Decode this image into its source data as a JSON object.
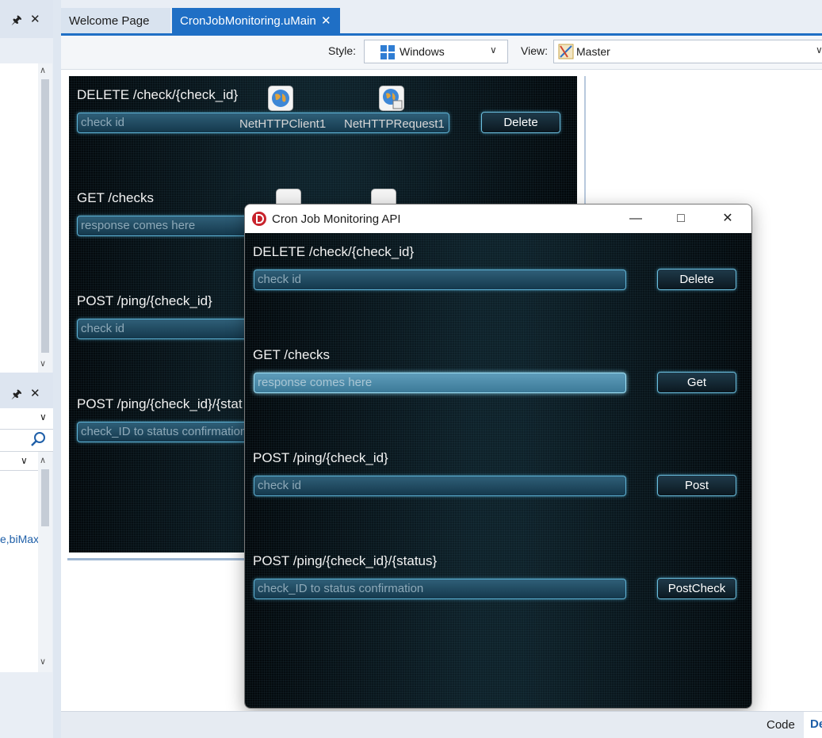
{
  "tabs": [
    {
      "label": "Welcome Page",
      "active": false
    },
    {
      "label": "CronJobMonitoring.uMain",
      "active": true
    }
  ],
  "toolbar": {
    "style_label": "Style:",
    "style_value": "Windows",
    "view_label": "View:",
    "view_value": "Master"
  },
  "left_panel": {
    "truncated_text": "e,biMax"
  },
  "designer_form": {
    "sections": [
      {
        "heading": "DELETE /check/{check_id}",
        "placeholder": "check id",
        "button": "Delete"
      },
      {
        "heading": "GET /checks",
        "placeholder": "response comes here"
      },
      {
        "heading": "POST /ping/{check_id}",
        "placeholder": "check id"
      },
      {
        "heading": "POST /ping/{check_id}/{stat",
        "placeholder": "check_ID to status confirmation"
      }
    ],
    "components": [
      "NetHTTPClient1",
      "NetHTTPRequest1"
    ]
  },
  "app_window": {
    "title": "Cron Job Monitoring API",
    "sections": [
      {
        "heading": "DELETE /check/{check_id}",
        "placeholder": "check id",
        "button": "Delete"
      },
      {
        "heading": "GET /checks",
        "placeholder": "response comes here",
        "button": "Get"
      },
      {
        "heading": "POST /ping/{check_id}",
        "placeholder": "check id",
        "button": "Post"
      },
      {
        "heading": "POST /ping/{check_id}/{status}",
        "placeholder": "check_ID to status confirmation",
        "button": "PostCheck"
      }
    ]
  },
  "bottom_tabs": {
    "code": "Code",
    "design": "De"
  },
  "colors": {
    "accent": "#1f6fc5",
    "field_border": "#5fb3d6",
    "form_bg": "#03080b"
  }
}
